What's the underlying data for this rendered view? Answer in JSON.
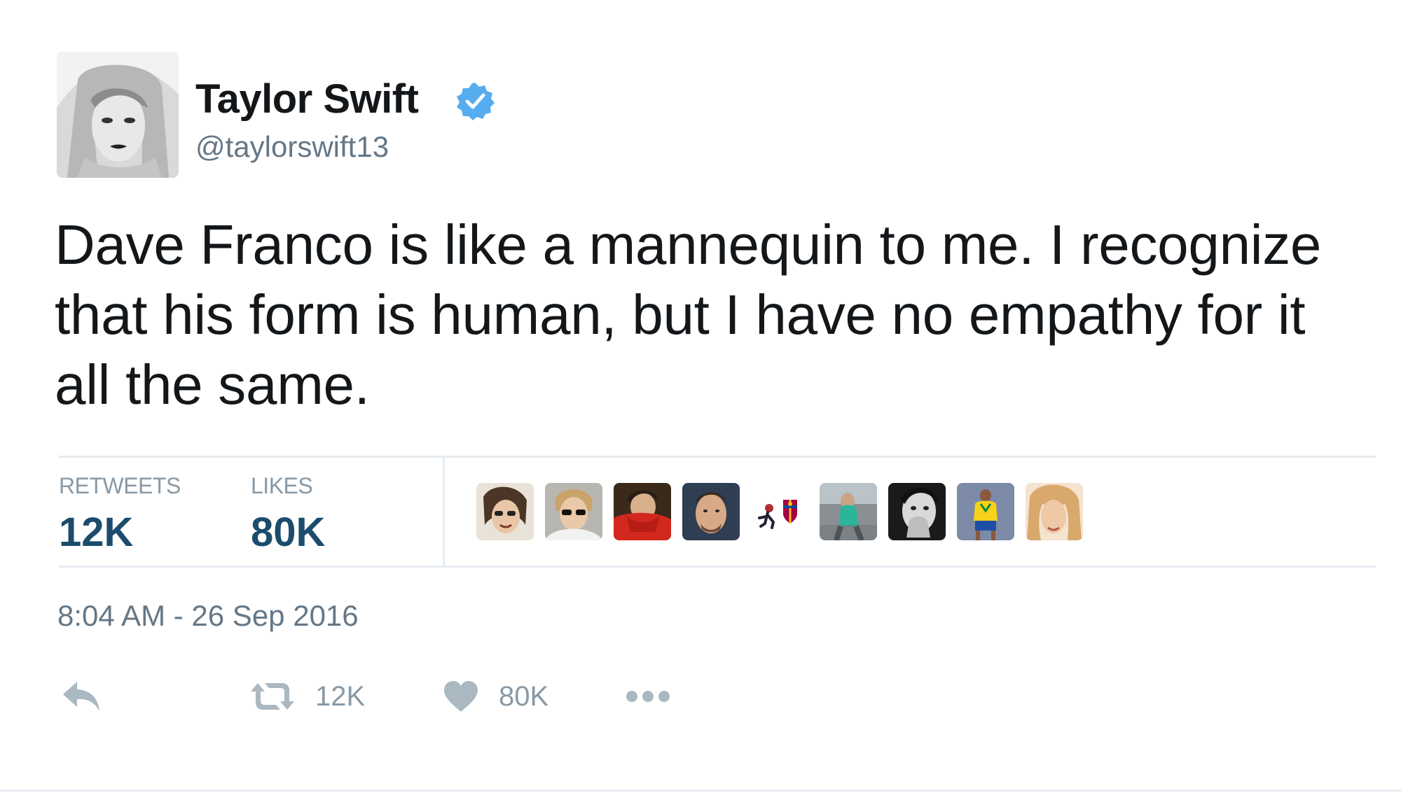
{
  "author": {
    "display_name": "Taylor Swift",
    "handle": "@taylorswift13",
    "verified": true,
    "verified_icon": "verified-badge-icon",
    "accent_color": "#55acee"
  },
  "tweet": {
    "text": "Dave Franco is like a mannequin to me. I recognize that his form is human, but I have no empathy for it all the same.",
    "timestamp": "8:04 AM - 26 Sep 2016"
  },
  "stats": {
    "retweets_label": "RETWEETS",
    "retweets_value": "12K",
    "likes_label": "LIKES",
    "likes_value": "80K",
    "value_color": "#1b4c6c"
  },
  "likers": [
    {
      "name": "liker-avatar-1"
    },
    {
      "name": "liker-avatar-2"
    },
    {
      "name": "liker-avatar-3"
    },
    {
      "name": "liker-avatar-4"
    },
    {
      "name": "liker-avatar-5"
    },
    {
      "name": "liker-avatar-6"
    },
    {
      "name": "liker-avatar-7"
    },
    {
      "name": "liker-avatar-8"
    },
    {
      "name": "liker-avatar-9"
    }
  ],
  "actions": {
    "reply_icon": "reply-icon",
    "retweet_icon": "retweet-icon",
    "retweet_count": "12K",
    "like_icon": "heart-icon",
    "like_count": "80K",
    "more_icon": "more-dots-icon"
  }
}
